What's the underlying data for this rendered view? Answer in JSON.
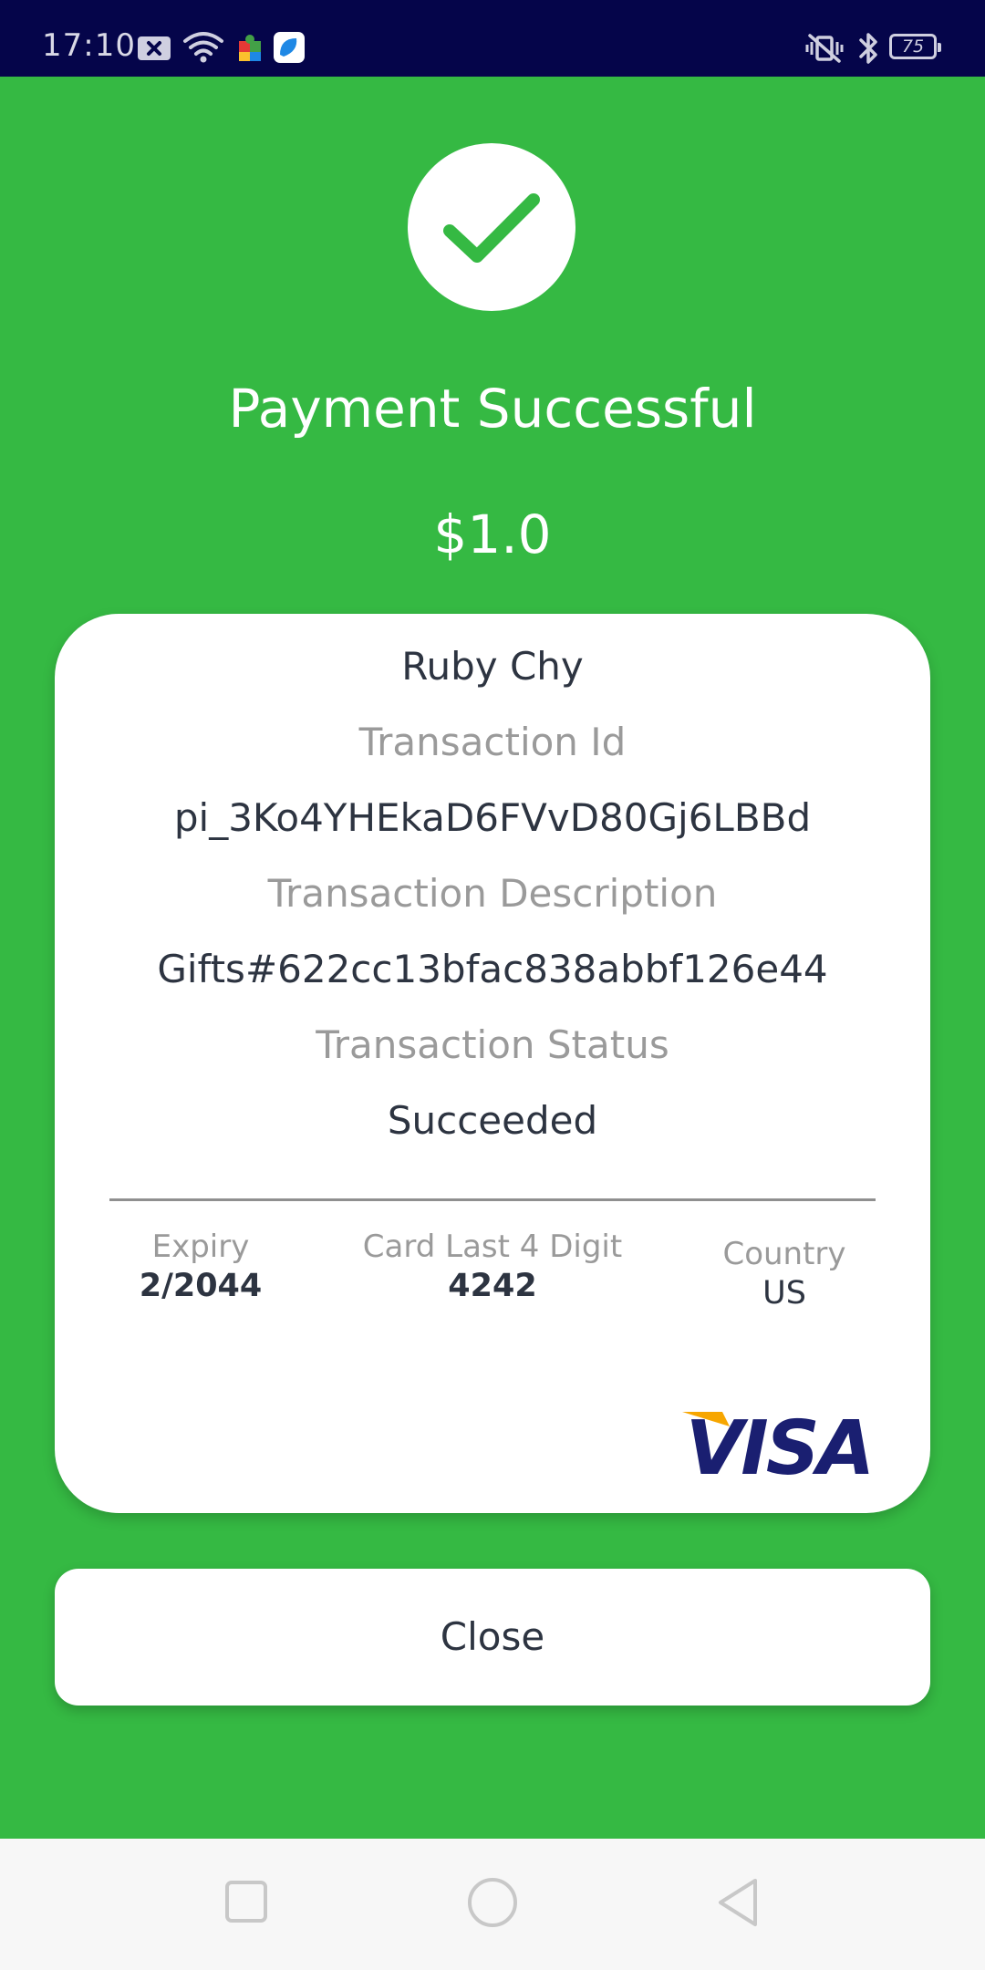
{
  "status_bar": {
    "time": "17:10",
    "battery": "75",
    "icons": [
      "notification-x-icon",
      "wifi-icon",
      "puzzle-app-icon",
      "blue-app-icon",
      "vibrate-icon",
      "bluetooth-icon",
      "battery-icon"
    ]
  },
  "payment": {
    "title": "Payment Successful",
    "amount": "$1.0"
  },
  "details": {
    "customer_name": "Ruby Chy",
    "transaction_id_label": "Transaction Id",
    "transaction_id": "pi_3Ko4YHEkaD6FVvD80Gj6LBBd",
    "description_label": "Transaction Description",
    "description": "Gifts#622cc13bfac838abbf126e44",
    "status_label": "Transaction Status",
    "status": "Succeeded"
  },
  "card_info": {
    "expiry_label": "Expiry",
    "expiry": "2/2044",
    "last4_label": "Card Last 4 Digit",
    "last4": "4242",
    "country_label": "Country",
    "country": "US",
    "brand_logo": "VISA"
  },
  "actions": {
    "close_label": "Close"
  },
  "nav_bar": {
    "buttons": [
      "recents-square-icon",
      "home-circle-icon",
      "back-triangle-icon"
    ]
  },
  "colors": {
    "background": "#35b943",
    "status_bar": "#05054a",
    "text_dark": "#2d3441",
    "text_muted": "#9a9a9a",
    "visa_blue": "#1a1f71",
    "visa_gold": "#f7a600"
  }
}
